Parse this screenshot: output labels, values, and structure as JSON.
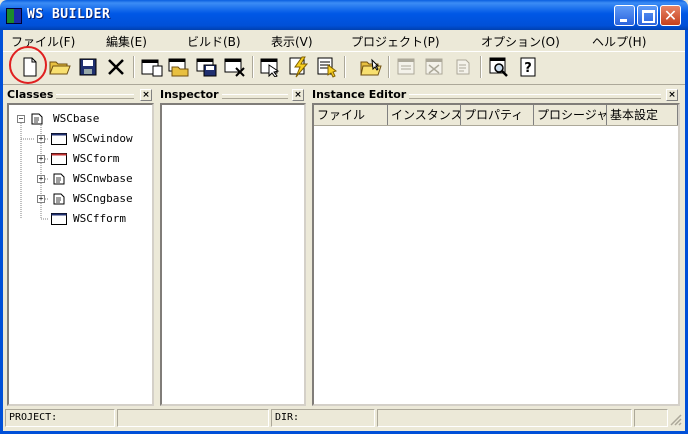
{
  "window": {
    "title": "WS BUILDER"
  },
  "menu": [
    "ファイル(F)",
    "編集(E)",
    "ビルド(B)",
    "表示(V)",
    "プロジェクト(P)",
    "オプション(O)",
    "ヘルプ(H)"
  ],
  "toolbar_icons": [
    "new-file-icon",
    "open-folder-icon",
    "save-icon",
    "delete-icon",
    "new-form-icon",
    "open-form-icon",
    "save-form-icon",
    "close-form-icon",
    "inspect-icon",
    "build-icon",
    "run-icon",
    "open-project-folder-icon",
    "disabled-form-icon",
    "disabled-class-icon",
    "disabled-list-icon",
    "preview-icon",
    "help-icon"
  ],
  "panes": {
    "classes": {
      "title": "Classes",
      "close": "×"
    },
    "inspector": {
      "title": "Inspector",
      "close": "×"
    },
    "instance_editor": {
      "title": "Instance Editor",
      "close": "×"
    }
  },
  "class_tree": [
    {
      "label": "WSCbase",
      "expander": "−",
      "icon": "class-doc-icon"
    },
    {
      "label": "WSCwindow",
      "expander": "+",
      "icon": "window-icon"
    },
    {
      "label": "WSCform",
      "expander": "+",
      "icon": "form-icon"
    },
    {
      "label": "WSCnwbase",
      "expander": "+",
      "icon": "class-doc-icon"
    },
    {
      "label": "WSCngbase",
      "expander": "+",
      "icon": "class-doc-icon"
    },
    {
      "label": "WSCfform",
      "expander": "",
      "icon": "window-icon"
    }
  ],
  "editor_tabs": [
    "ファイル",
    "インスタンス",
    "プロパティ",
    "プロシージャ",
    "基本設定"
  ],
  "status": {
    "project_label": "PROJECT:",
    "dir_label": "DIR:"
  },
  "colors": {
    "title_blue": "#0058e6",
    "highlight": "#e02020",
    "face": "#ece9d8"
  }
}
